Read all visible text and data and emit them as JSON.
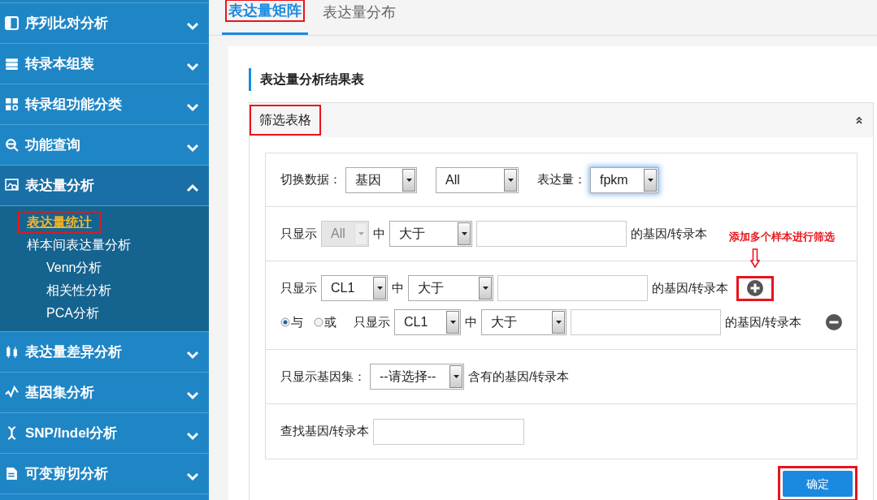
{
  "sidebar": {
    "items": [
      {
        "label": "序列比对分析",
        "expanded": false
      },
      {
        "label": "转录本组装",
        "expanded": false
      },
      {
        "label": "转录组功能分类",
        "expanded": false
      },
      {
        "label": "功能查询",
        "expanded": false
      },
      {
        "label": "表达量分析",
        "expanded": true,
        "children": [
          {
            "label": "表达量统计",
            "selected": true,
            "annotated": true
          },
          {
            "label": "样本间表达量分析",
            "selected": false,
            "annotated": false,
            "children": [
              {
                "label": "Venn分析",
                "selected": false,
                "annotated": false
              },
              {
                "label": "相关性分析",
                "selected": false,
                "annotated": false
              },
              {
                "label": "PCA分析",
                "selected": false,
                "annotated": false
              }
            ]
          }
        ]
      },
      {
        "label": "表达量差异分析",
        "expanded": false
      },
      {
        "label": "基因集分析",
        "expanded": false
      },
      {
        "label": "SNP/Indel分析",
        "expanded": false
      },
      {
        "label": "可变剪切分析",
        "expanded": false
      }
    ]
  },
  "tabs": [
    {
      "label": "表达量矩阵",
      "selected": true,
      "annotated": true
    },
    {
      "label": "表达量分布",
      "selected": false,
      "annotated": false
    }
  ],
  "section_title": "表达量分析结果表",
  "panel": {
    "title": "筛选表格",
    "annotated": true,
    "expanded": true,
    "rows": [
      {
        "lines": [
          {
            "parts": [
              {
                "kind": "label",
                "text": "切换数据："
              },
              {
                "kind": "select",
                "value": "基因",
                "disabled": false,
                "focused": false
              },
              {
                "kind": "select",
                "value": "All",
                "disabled": false,
                "focused": false
              },
              {
                "kind": "label",
                "text": "表达量："
              },
              {
                "kind": "select",
                "value": "fpkm",
                "disabled": false,
                "focused": true
              }
            ]
          }
        ]
      },
      {
        "lines": [
          {
            "parts": [
              {
                "kind": "label",
                "text": "只显示"
              },
              {
                "kind": "select",
                "value": "All",
                "disabled": true,
                "focused": false
              },
              {
                "kind": "label",
                "text": "中"
              },
              {
                "kind": "select",
                "value": "大于",
                "disabled": false,
                "focused": false
              },
              {
                "kind": "input"
              },
              {
                "kind": "label",
                "text": "的基因/转录本"
              }
            ]
          }
        ]
      },
      {
        "lines": [
          {
            "parts": [
              {
                "kind": "label",
                "text": "只显示"
              },
              {
                "kind": "select",
                "value": "CL1",
                "disabled": false,
                "focused": false
              },
              {
                "kind": "label",
                "text": "中"
              },
              {
                "kind": "select",
                "value": "大于",
                "disabled": false,
                "focused": false
              },
              {
                "kind": "input"
              },
              {
                "kind": "label",
                "text": "的基因/转录本"
              },
              {
                "kind": "add_button",
                "annotated": true,
                "note": "添加多个样本进行筛选"
              }
            ]
          },
          {
            "parts": [
              {
                "kind": "radio",
                "label": "与",
                "checked": true
              },
              {
                "kind": "radio",
                "label": "或",
                "checked": false
              },
              {
                "kind": "label",
                "text": "只显示"
              },
              {
                "kind": "select",
                "value": "CL1",
                "disabled": false,
                "focused": false
              },
              {
                "kind": "label",
                "text": "中"
              },
              {
                "kind": "select",
                "value": "大于",
                "disabled": false,
                "focused": false
              },
              {
                "kind": "input"
              },
              {
                "kind": "label",
                "text": "的基因/转录本"
              },
              {
                "kind": "remove_button",
                "annotated": false
              }
            ]
          }
        ]
      },
      {
        "lines": [
          {
            "parts": [
              {
                "kind": "label",
                "text": "只显示基因集："
              },
              {
                "kind": "select",
                "value": "--请选择--",
                "disabled": false,
                "focused": false
              },
              {
                "kind": "label",
                "text": "含有的基因/转录本"
              }
            ]
          }
        ]
      },
      {
        "lines": [
          {
            "parts": [
              {
                "kind": "label",
                "text": "查找基因/转录本"
              },
              {
                "kind": "input"
              }
            ]
          }
        ]
      }
    ]
  },
  "confirm_button": {
    "label": "确定",
    "annotated": true
  }
}
